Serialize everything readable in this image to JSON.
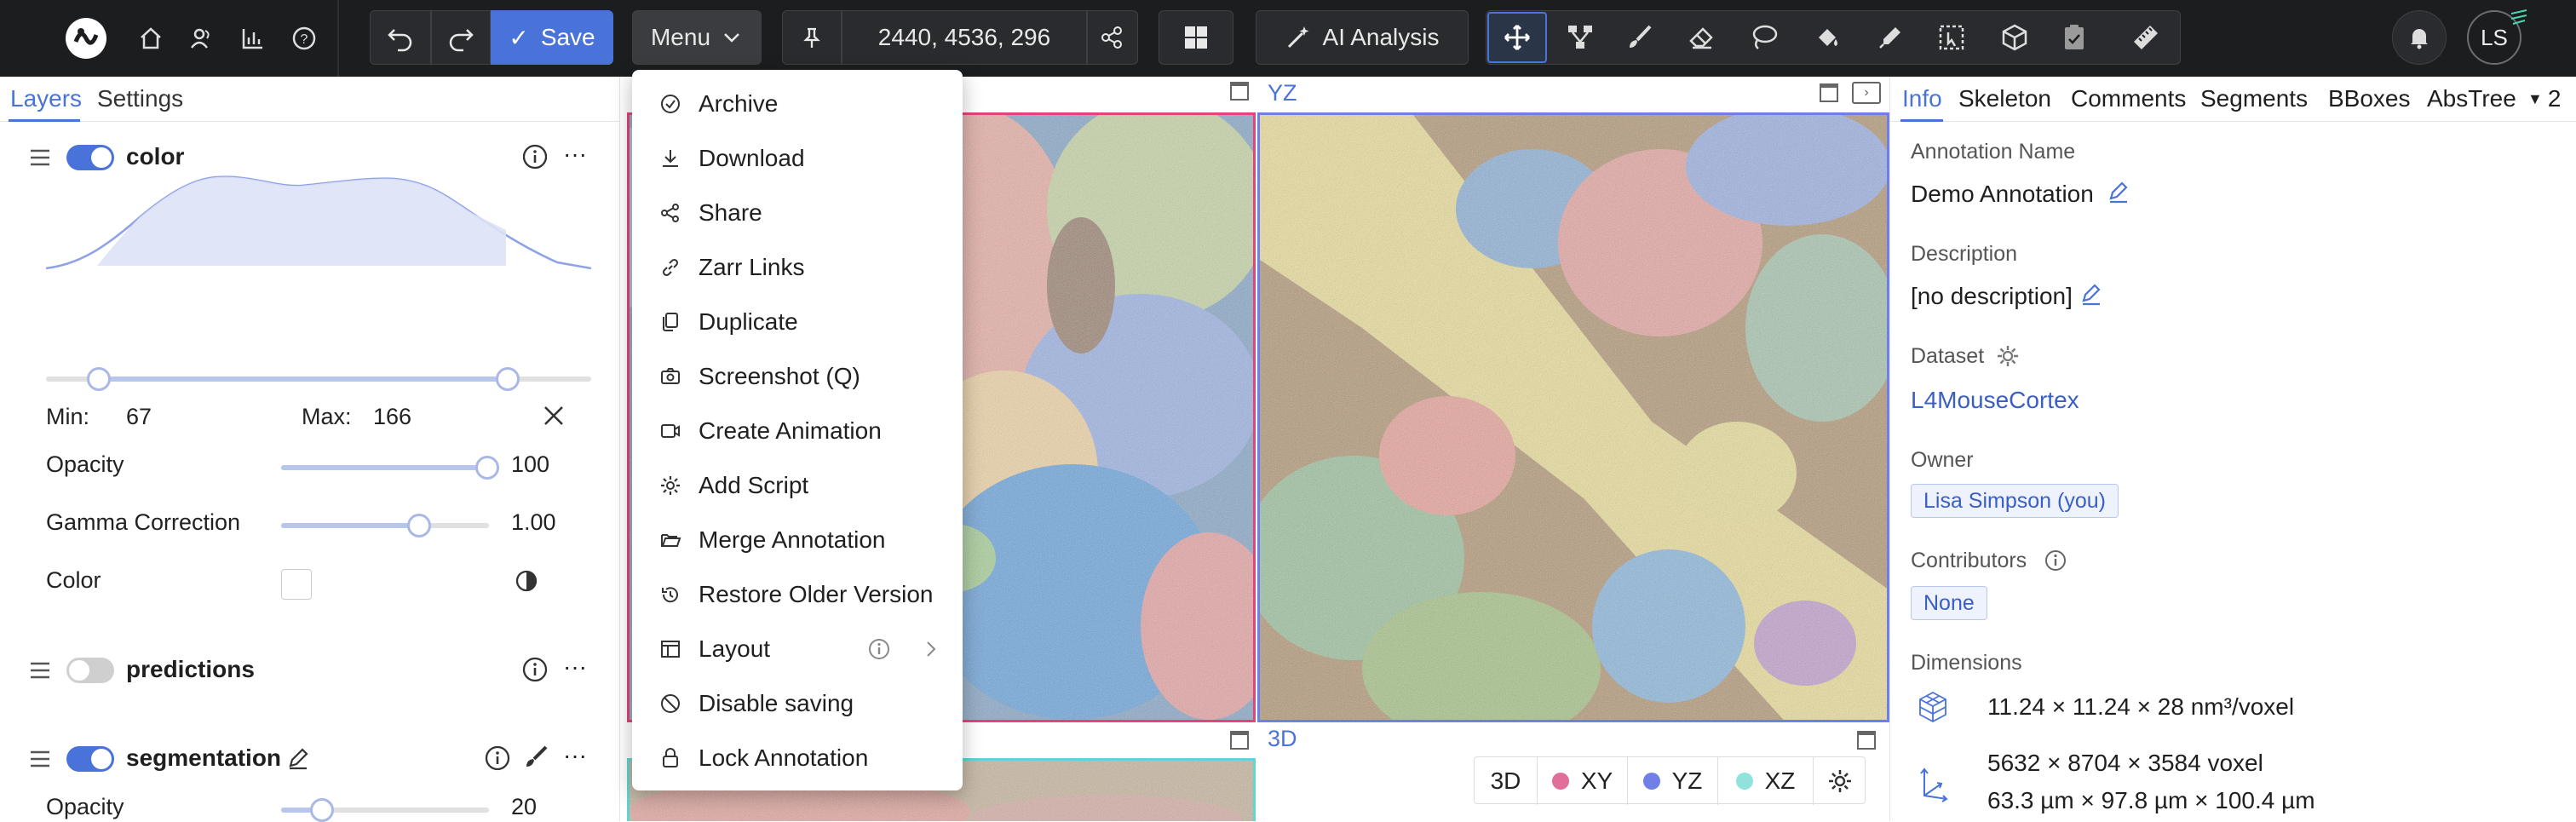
{
  "topbar": {
    "save_label": "Save",
    "menu_label": "Menu",
    "position": "2440, 4536, 296",
    "ai_label": "AI Analysis",
    "avatar_initials": "LS",
    "nav_icons": [
      "logo-icon",
      "home-icon",
      "users-icon",
      "stats-icon",
      "help-icon"
    ],
    "tools": [
      "move-icon",
      "skeleton-icon",
      "brush-icon",
      "eraser-icon",
      "lasso-icon",
      "fill-icon",
      "picker-icon",
      "bbox-icon",
      "cube-icon",
      "proofread-icon",
      "ruler-icon"
    ]
  },
  "left_panel": {
    "tabs": [
      "Layers",
      "Settings"
    ],
    "layers": {
      "color": {
        "name": "color",
        "min_label": "Min:",
        "min_value": "67",
        "max_label": "Max:",
        "max_value": "166",
        "opacity_label": "Opacity",
        "opacity_value": "100",
        "gamma_label": "Gamma Correction",
        "gamma_value": "1.00",
        "color_label": "Color"
      },
      "predictions": {
        "name": "predictions"
      },
      "segmentation": {
        "name": "segmentation",
        "opacity_label": "Opacity",
        "opacity_value": "20"
      }
    }
  },
  "viewports": {
    "yz_label": "YZ",
    "td_label": "3D",
    "td_buttons": {
      "b3d": "3D",
      "xy": "XY",
      "yz": "YZ",
      "xz": "XZ"
    }
  },
  "menu": {
    "items": [
      {
        "label": "Archive",
        "icon": "archive-icon"
      },
      {
        "label": "Download",
        "icon": "download-icon"
      },
      {
        "label": "Share",
        "icon": "share-icon"
      },
      {
        "label": "Zarr Links",
        "icon": "link-icon"
      },
      {
        "label": "Duplicate",
        "icon": "duplicate-icon"
      },
      {
        "label": "Screenshot (Q)",
        "icon": "camera-icon"
      },
      {
        "label": "Create Animation",
        "icon": "video-icon"
      },
      {
        "label": "Add Script",
        "icon": "gear-icon"
      },
      {
        "label": "Merge Annotation",
        "icon": "folder-icon"
      },
      {
        "label": "Restore Older Version",
        "icon": "history-icon"
      },
      {
        "label": "Layout",
        "icon": "layout-icon"
      },
      {
        "label": "Disable saving",
        "icon": "stop-icon"
      },
      {
        "label": "Lock Annotation",
        "icon": "lock-icon"
      }
    ]
  },
  "right_panel": {
    "tabs": [
      "Info",
      "Skeleton",
      "Comments",
      "Segments",
      "BBoxes",
      "AbsTree"
    ],
    "overflow": "2",
    "annotation_name_label": "Annotation Name",
    "annotation_name": "Demo Annotation",
    "description_label": "Description",
    "description": "[no description]",
    "dataset_label": "Dataset",
    "dataset": "L4MouseCortex",
    "owner_label": "Owner",
    "owner": "Lisa Simpson (you)",
    "contributors_label": "Contributors",
    "contributors": "None",
    "dimensions_label": "Dimensions",
    "voxel_size": "11.24 × 11.24 × 28 nm³/voxel",
    "extent_voxel": "5632 × 8704 × 3584 voxel",
    "extent_um": "63.3 µm × 97.8 µm × 100.4 µm"
  },
  "colors": {
    "accent": "#4a73d9",
    "xy_border": "#e0457b",
    "yz_border": "#6f7fe8",
    "xz_border": "#5fd6d0"
  }
}
